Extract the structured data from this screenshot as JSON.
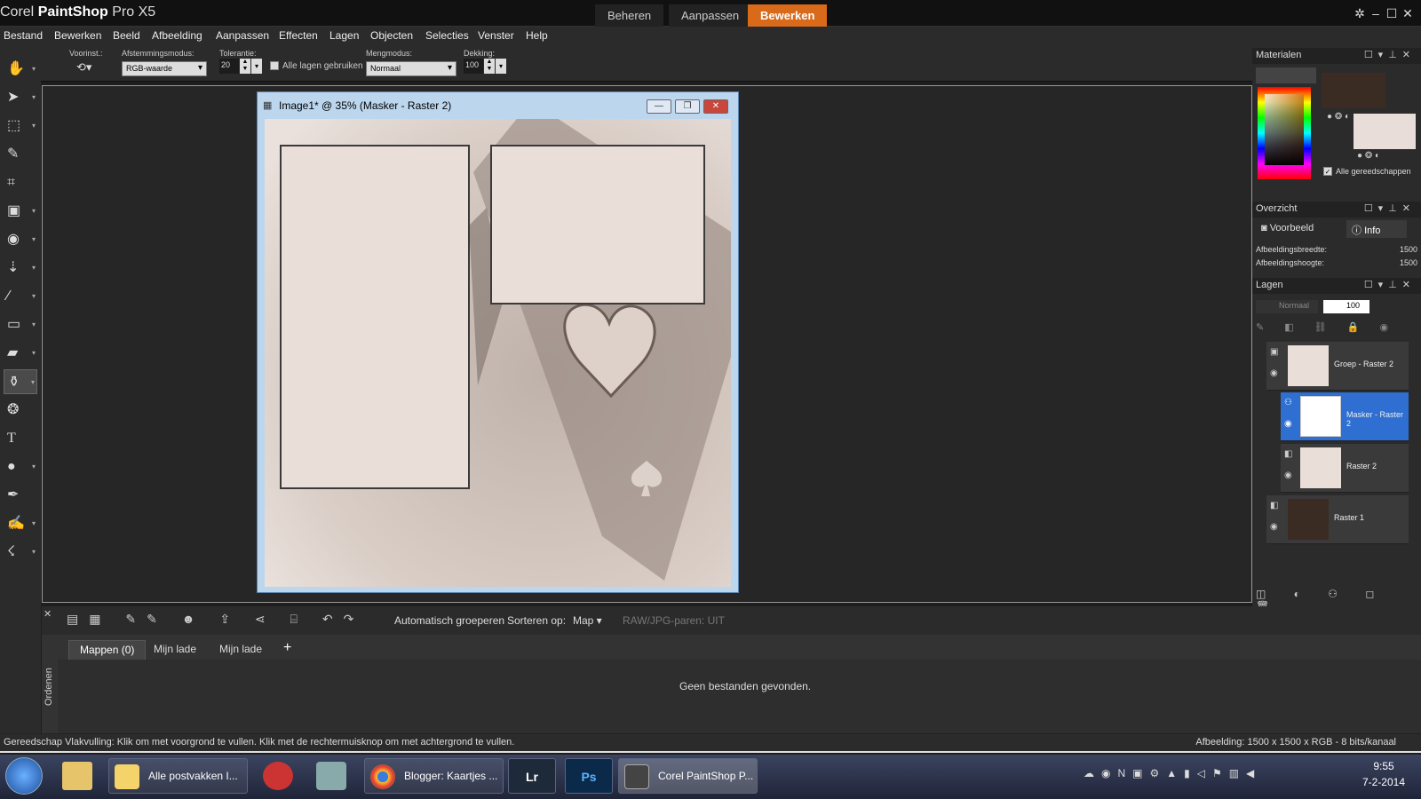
{
  "window": {
    "title_brand": "Corel",
    "title_product": "PaintShop",
    "title_version": "Pro X5",
    "tabs": [
      {
        "label": "Beheren"
      },
      {
        "label": "Aanpassen"
      },
      {
        "label": "Bewerken"
      }
    ]
  },
  "menu": {
    "items": [
      "Bestand",
      "Bewerken",
      "Beeld",
      "Afbeelding",
      "Aanpassen",
      "Effecten",
      "Lagen",
      "Objecten",
      "Selecties",
      "Venster",
      "Help"
    ]
  },
  "options": {
    "preset_label": "Voorinst.:",
    "match_mode_label": "Afstemmingsmodus:",
    "match_mode_value": "RGB-waarde",
    "tolerance_label": "Tolerantie:",
    "tolerance_value": "20",
    "all_layers_label": "Alle lagen gebruiken",
    "blend_mode_label": "Mengmodus:",
    "blend_mode_value": "Normaal",
    "opacity_label": "Dekking:",
    "opacity_value": "100"
  },
  "image_window": {
    "title": "Image1* @  35% (Masker - Raster 2)"
  },
  "materials": {
    "title": "Materialen",
    "all_tools_label": "Alle gereedschappen",
    "foreground_color": "#3a2c22",
    "background_color": "#e8ddd8"
  },
  "overview": {
    "title": "Overzicht",
    "tab_preview": "Voorbeeld",
    "tab_info": "Info",
    "width_label": "Afbeeldingsbreedte:",
    "width_value": "1500",
    "height_label": "Afbeeldingshoogte:",
    "height_value": "1500"
  },
  "layers": {
    "title": "Lagen",
    "blend_mode": "Normaal",
    "opacity": "100",
    "items": [
      {
        "name": "Groep - Raster 2"
      },
      {
        "name": "Masker - Raster 2"
      },
      {
        "name": "Raster 2"
      },
      {
        "name": "Raster 1"
      }
    ]
  },
  "organizer": {
    "auto_group_label": "Automatisch groeperen",
    "sort_label": "Sorteren op:",
    "sort_value": "Map",
    "raw_jpg_label": "RAW/JPG-paren: UIT",
    "tabs": [
      {
        "label": "Mappen (0)"
      },
      {
        "label": "Mijn lade"
      },
      {
        "label": "Mijn lade"
      }
    ],
    "empty_message": "Geen bestanden gevonden.",
    "side_label": "Ordenen"
  },
  "status": {
    "left": "Gereedschap Vlakvulling: Klik om met voorgrond te vullen. Klik met de rechtermuisknop om met achtergrond te vullen.",
    "right": "Afbeelding:  1500 x 1500 x RGB - 8 bits/kanaal"
  },
  "taskbar": {
    "items": [
      {
        "label": "Alle postvakken I..."
      },
      {
        "label": "Blogger: Kaartjes ..."
      },
      {
        "label": "Corel PaintShop P..."
      }
    ],
    "lr_label": "Lr",
    "ps_label": "Ps",
    "time": "9:55",
    "date": "7-2-2014"
  }
}
